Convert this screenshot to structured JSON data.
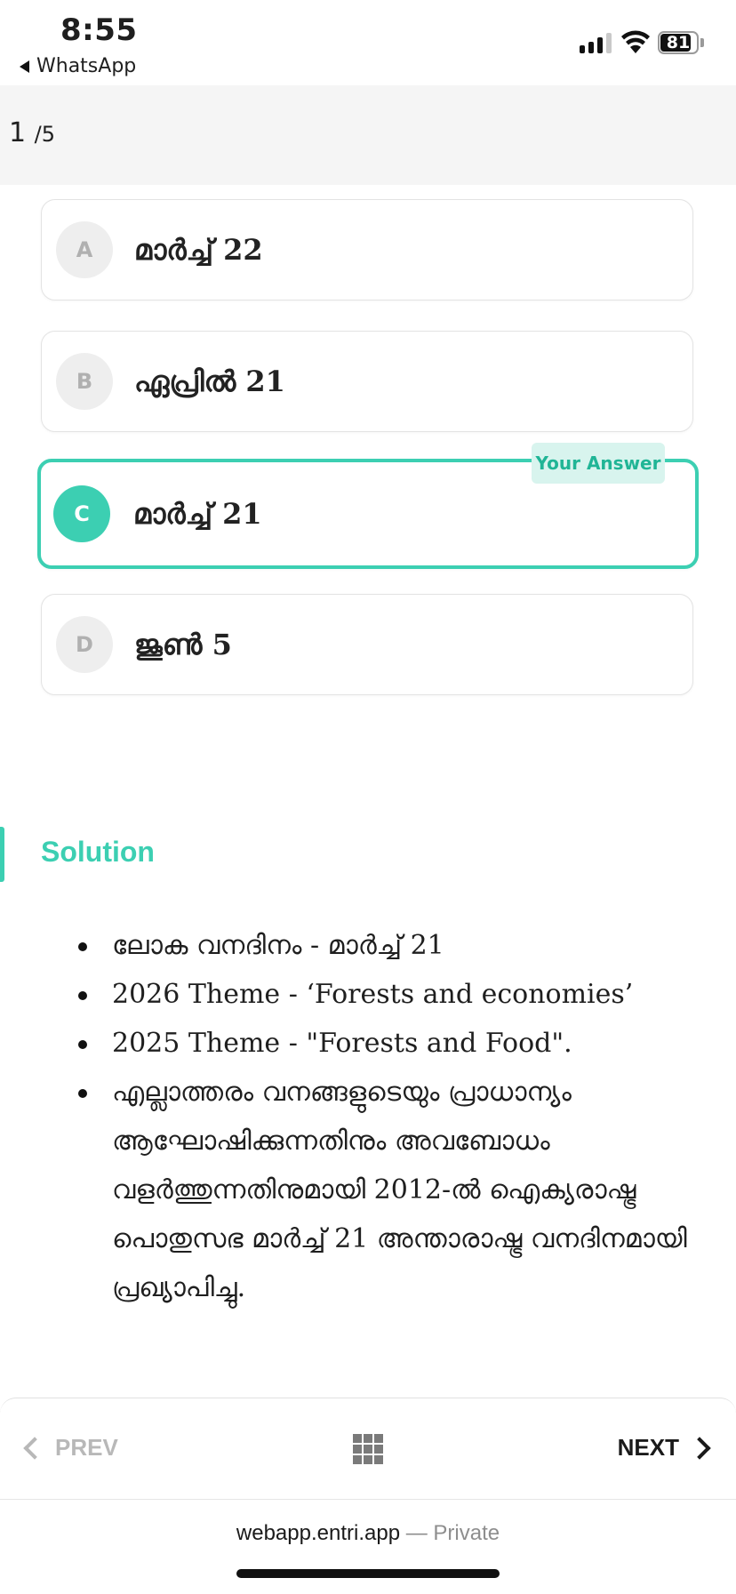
{
  "status_bar": {
    "time": "8:55",
    "back_app": "WhatsApp",
    "battery": "81"
  },
  "question": {
    "current": "1",
    "total": "/5"
  },
  "options": [
    {
      "letter": "A",
      "text": "മാർച്ച് 22",
      "selected": false
    },
    {
      "letter": "B",
      "text": "ഏപ്രിൽ 21",
      "selected": false
    },
    {
      "letter": "C",
      "text": "മാർച്ച് 21",
      "selected": true
    },
    {
      "letter": "D",
      "text": "ജൂൺ 5",
      "selected": false
    }
  ],
  "answer_badge": "Your Answer",
  "solution": {
    "title": "Solution",
    "points": [
      "ലോക വനദിനം - മാർച്ച് 21",
      "2026 Theme - ‘Forests and economies’",
      "2025 Theme - \"Forests and Food\".",
      "എല്ലാത്തരം വനങ്ങളുടെയും പ്രാധാന്യം ആഘോഷിക്കുന്നതിനും അവബോധം വളർത്തുന്നതിനുമായി 2012-ൽ ഐക്യരാഷ്ട്ര പൊതുസഭ മാർച്ച് 21 അന്താരാഷ്ട്ര വനദിനമായി പ്രഖ്യാപിച്ചു."
    ]
  },
  "nav": {
    "prev": "PREV",
    "next": "NEXT"
  },
  "browser": {
    "domain": "webapp.entri.app",
    "suffix": " — Private"
  },
  "colors": {
    "accent": "#3ccfb2",
    "badge_bg": "#d8f4ee"
  }
}
